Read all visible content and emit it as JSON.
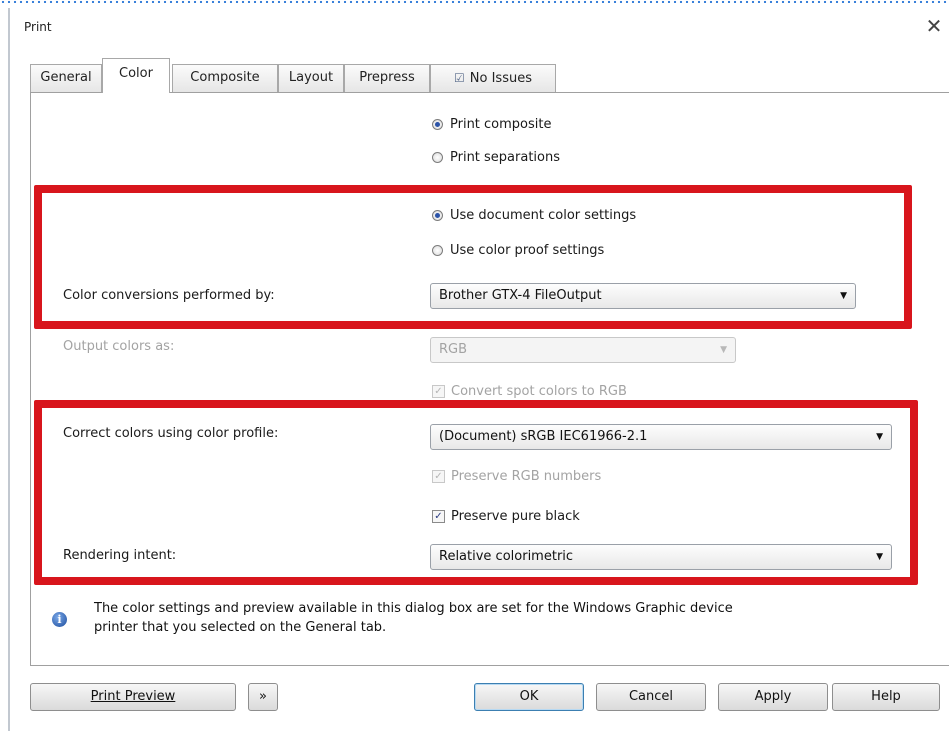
{
  "window": {
    "title": "Print",
    "close_glyph": "✕"
  },
  "tabs": [
    {
      "label": "General",
      "active": false
    },
    {
      "label": "Color",
      "active": true
    },
    {
      "label": "Composite",
      "active": false
    },
    {
      "label": "Layout",
      "active": false
    },
    {
      "label": "Prepress",
      "active": false
    },
    {
      "label": "No Issues",
      "active": false,
      "icon": "issues-icon"
    }
  ],
  "print_mode": {
    "options": [
      {
        "label": "Print composite",
        "checked": true
      },
      {
        "label": "Print separations",
        "checked": false
      }
    ]
  },
  "color_settings": {
    "options": [
      {
        "label": "Use document color settings",
        "checked": true
      },
      {
        "label": "Use color proof settings",
        "checked": false
      }
    ]
  },
  "conversions": {
    "label": "Color conversions performed by:",
    "value": "Brother GTX-4 FileOutput"
  },
  "output": {
    "label": "Output colors as:",
    "value": "RGB",
    "convert_spot_label": "Convert spot colors to RGB",
    "convert_spot_checked": true
  },
  "profile": {
    "label": "Correct colors using color profile:",
    "value": "(Document) sRGB IEC61966-2.1",
    "preserve_rgb_label": "Preserve RGB numbers",
    "preserve_rgb_checked": true,
    "preserve_black_label": "Preserve pure black",
    "preserve_black_checked": true
  },
  "intent": {
    "label": "Rendering intent:",
    "value": "Relative colorimetric"
  },
  "info": {
    "icon": "info-icon",
    "text_line1": "The color settings and preview available in this dialog box are set for the Windows Graphic device",
    "text_line2": "printer that you selected on the General tab."
  },
  "buttons": {
    "print_preview": "Print Preview",
    "toggle_preview_glyph": "»",
    "ok": "OK",
    "cancel": "Cancel",
    "apply": "Apply",
    "help": "Help"
  },
  "colors": {
    "highlight": "#d8151c",
    "radio_dot": "#2b53a8"
  }
}
